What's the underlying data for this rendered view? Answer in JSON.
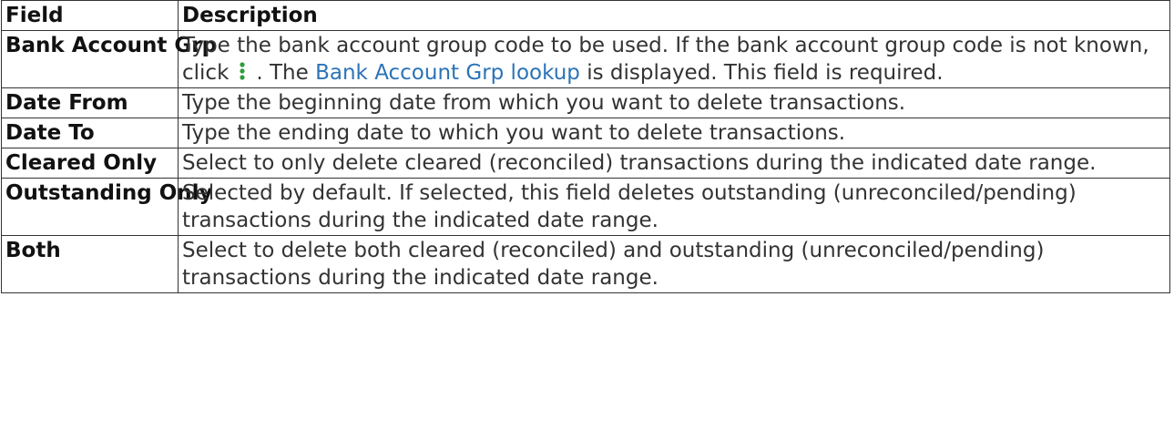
{
  "headers": {
    "field": "Field",
    "description": "Description"
  },
  "rows": [
    {
      "field": "Bank Account Grp",
      "desc_before": "Type the bank account group code to be used. If the bank account group code is not known, click",
      "icon": "kebab-icon",
      "desc_mid": ". The",
      "link": "Bank Account Grp lookup",
      "desc_after": "is displayed. This field is required."
    },
    {
      "field": "Date From",
      "desc": "Type the beginning date from which you want to delete transactions."
    },
    {
      "field": "Date To",
      "desc": "Type the ending date to which you want to delete transactions."
    },
    {
      "field": "Cleared Only",
      "desc": "Select to only delete cleared (reconciled) transactions during the indicated date range."
    },
    {
      "field": "Outstanding Only",
      "desc": "Selected by default. If selected, this field deletes outstanding (unreconciled/pending) transactions during the indicated date range."
    },
    {
      "field": "Both",
      "desc": "Select to delete both cleared (reconciled) and outstanding (unreconciled/pending) transactions during the indicated date range."
    }
  ],
  "colors": {
    "link": "#2b73b7",
    "icon": "#2e9c3a",
    "border": "#333333"
  }
}
